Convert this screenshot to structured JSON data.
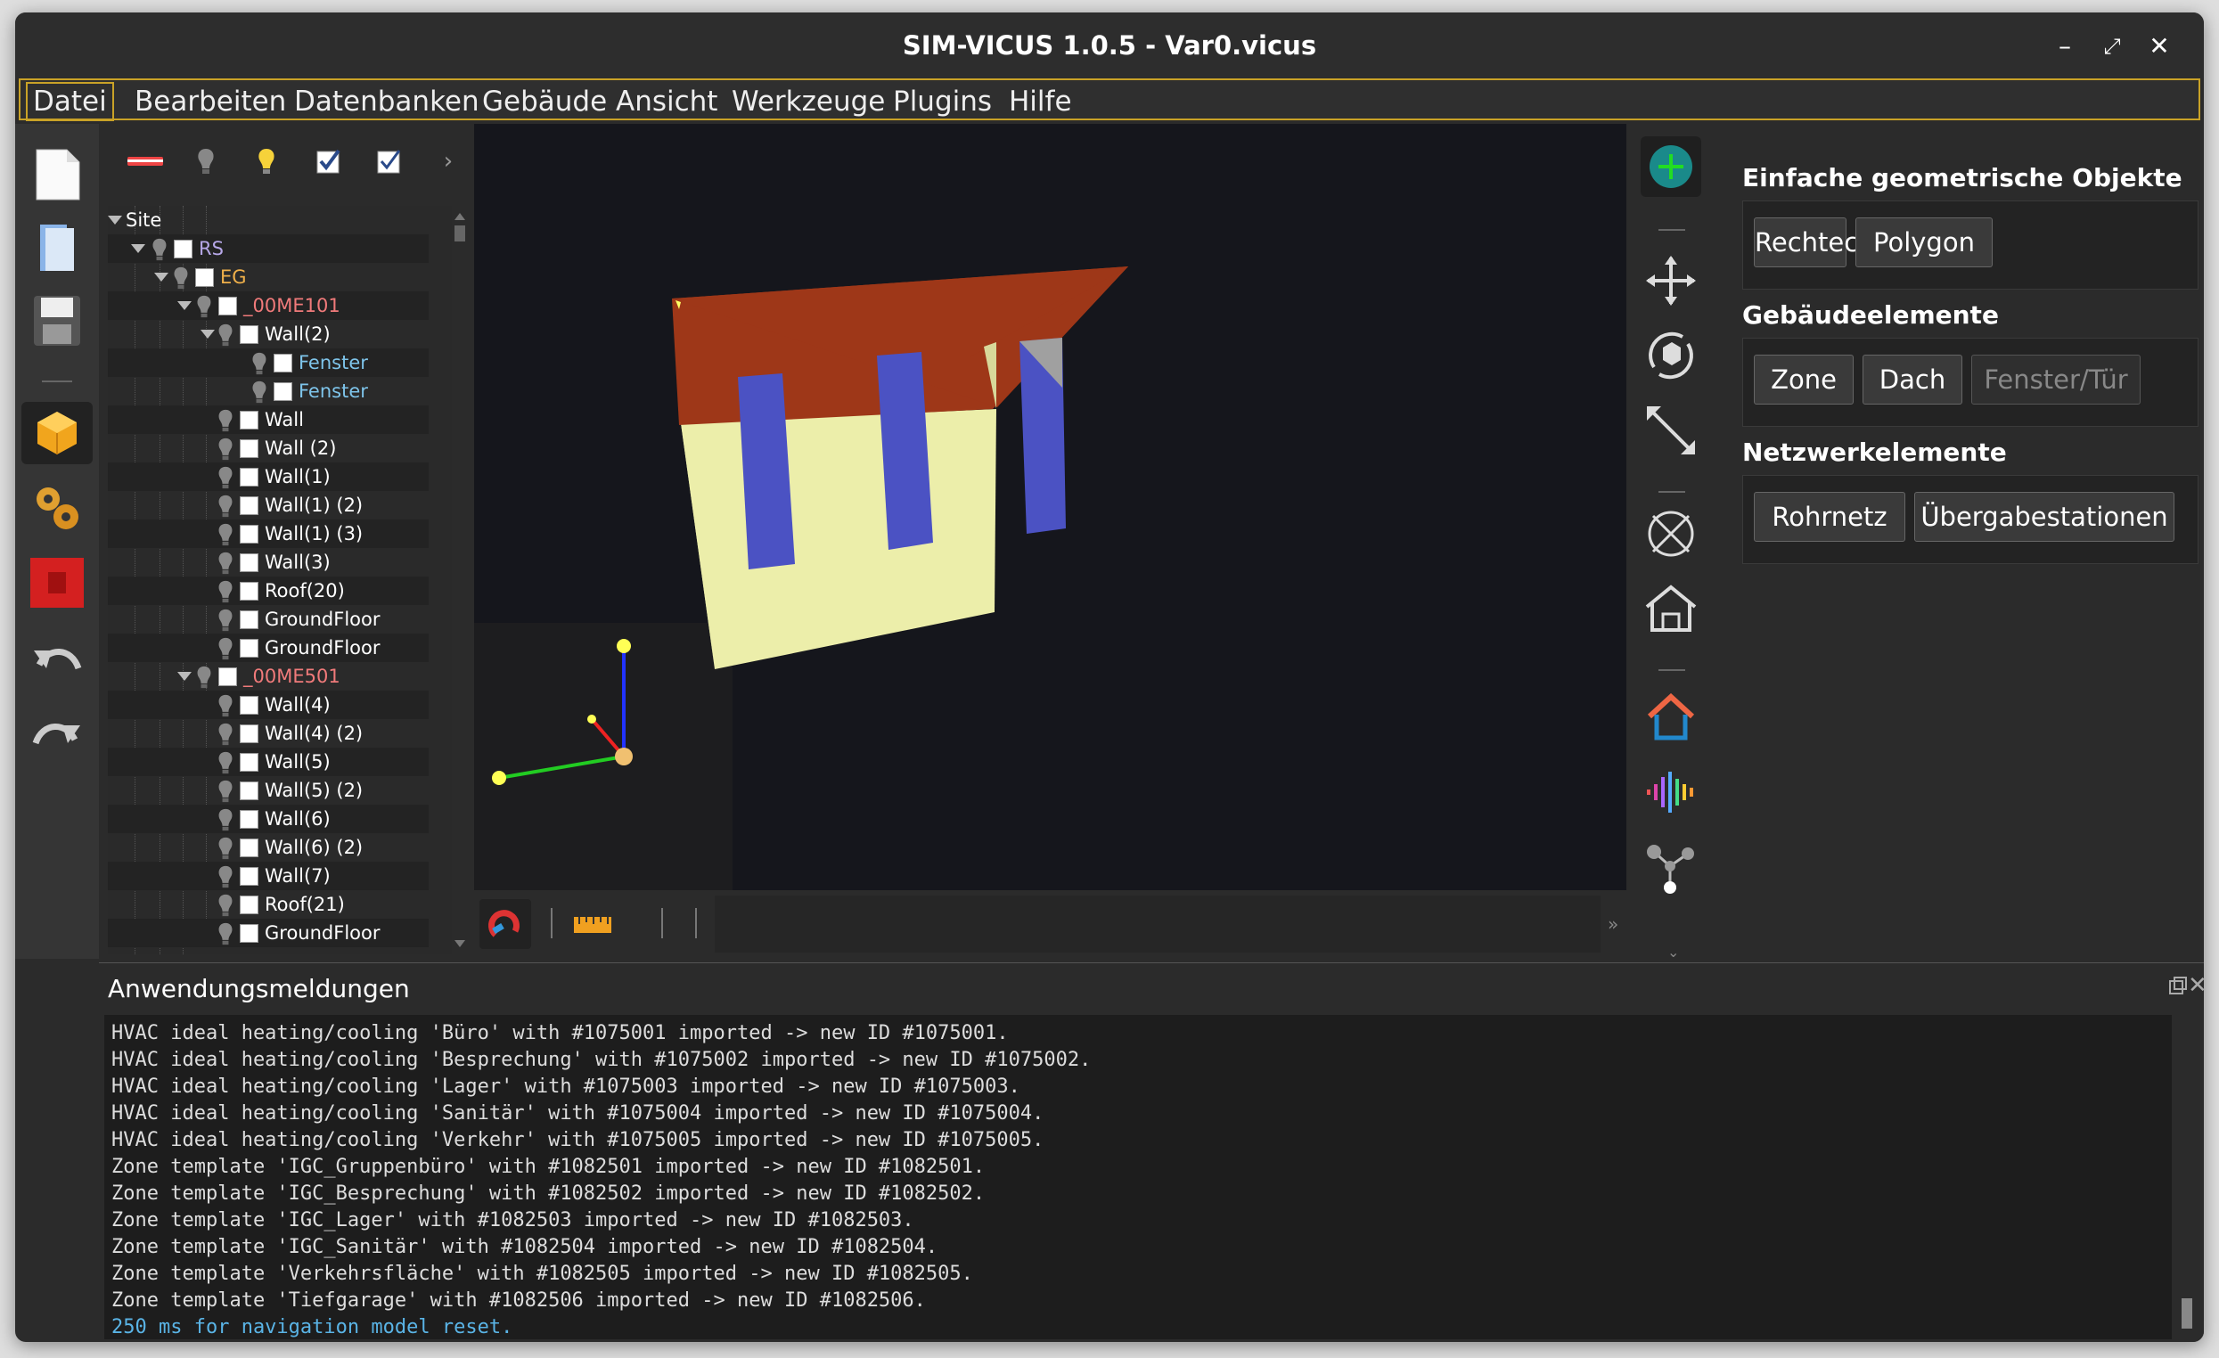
{
  "window": {
    "title": "SIM-VICUS 1.0.5 - Var0.vicus",
    "min": "–",
    "max": "⤢",
    "close": "✕"
  },
  "menu": [
    "Datei",
    "Bearbeiten",
    "Datenbanken",
    "Gebäude",
    "Ansicht",
    "Werkzeuge",
    "Plugins",
    "Hilfe"
  ],
  "tree": {
    "rows": [
      {
        "label": "Site",
        "color": "#ffffff"
      },
      {
        "label": "RS",
        "color": "#b7a8e8"
      },
      {
        "label": "EG",
        "color": "#f0b04a"
      },
      {
        "label": "_00ME101",
        "color": "#f07a7a"
      },
      {
        "label": "Wall(2)",
        "color": "#ffffff"
      },
      {
        "label": "Fenster",
        "color": "#7ec4ea"
      },
      {
        "label": "Fenster",
        "color": "#7ec4ea"
      },
      {
        "label": "Wall",
        "color": "#ffffff"
      },
      {
        "label": "Wall (2)",
        "color": "#ffffff"
      },
      {
        "label": "Wall(1)",
        "color": "#ffffff"
      },
      {
        "label": "Wall(1) (2)",
        "color": "#ffffff"
      },
      {
        "label": "Wall(1) (3)",
        "color": "#ffffff"
      },
      {
        "label": "Wall(3)",
        "color": "#ffffff"
      },
      {
        "label": "Roof(20)",
        "color": "#ffffff"
      },
      {
        "label": "GroundFloor",
        "color": "#ffffff"
      },
      {
        "label": "GroundFloor",
        "color": "#ffffff"
      },
      {
        "label": "_00ME501",
        "color": "#f07a7a"
      },
      {
        "label": "Wall(4)",
        "color": "#ffffff"
      },
      {
        "label": "Wall(4) (2)",
        "color": "#ffffff"
      },
      {
        "label": "Wall(5)",
        "color": "#ffffff"
      },
      {
        "label": "Wall(5) (2)",
        "color": "#ffffff"
      },
      {
        "label": "Wall(6)",
        "color": "#ffffff"
      },
      {
        "label": "Wall(6) (2)",
        "color": "#ffffff"
      },
      {
        "label": "Wall(7)",
        "color": "#ffffff"
      },
      {
        "label": "Roof(21)",
        "color": "#ffffff"
      },
      {
        "label": "GroundFloor",
        "color": "#ffffff"
      }
    ]
  },
  "panel": {
    "simple": {
      "title": "Einfache geometrische Objekte",
      "b1": "Rechteck",
      "b2": "Polygon"
    },
    "building": {
      "title": "Gebäudeelemente",
      "b1": "Zone",
      "b2": "Dach",
      "b3": "Fenster/Tür"
    },
    "network": {
      "title": "Netzwerkelemente",
      "b1": "Rohrnetz",
      "b2": "Übergabestationen"
    }
  },
  "messages": {
    "title": "Anwendungsmeldungen",
    "lines": [
      "HVAC ideal heating/cooling 'Büro' with #1075001 imported -> new ID #1075001.",
      "HVAC ideal heating/cooling 'Besprechung' with #1075002 imported -> new ID #1075002.",
      "HVAC ideal heating/cooling 'Lager' with #1075003 imported -> new ID #1075003.",
      "HVAC ideal heating/cooling 'Sanitär' with #1075004 imported -> new ID #1075004.",
      "HVAC ideal heating/cooling 'Verkehr' with #1075005 imported -> new ID #1075005.",
      "Zone template 'IGC_Gruppenbüro' with #1082501 imported -> new ID #1082501.",
      "Zone template 'IGC_Besprechung' with #1082502 imported -> new ID #1082502.",
      "Zone template 'IGC_Lager' with #1082503 imported -> new ID #1082503.",
      "Zone template 'IGC_Sanitär' with #1082504 imported -> new ID #1082504.",
      "Zone template 'Verkehrsfläche' with #1082505 imported -> new ID #1082505.",
      "Zone template 'Tiefgarage' with #1082506 imported -> new ID #1082506.",
      "250 ms for navigation model reset."
    ]
  }
}
